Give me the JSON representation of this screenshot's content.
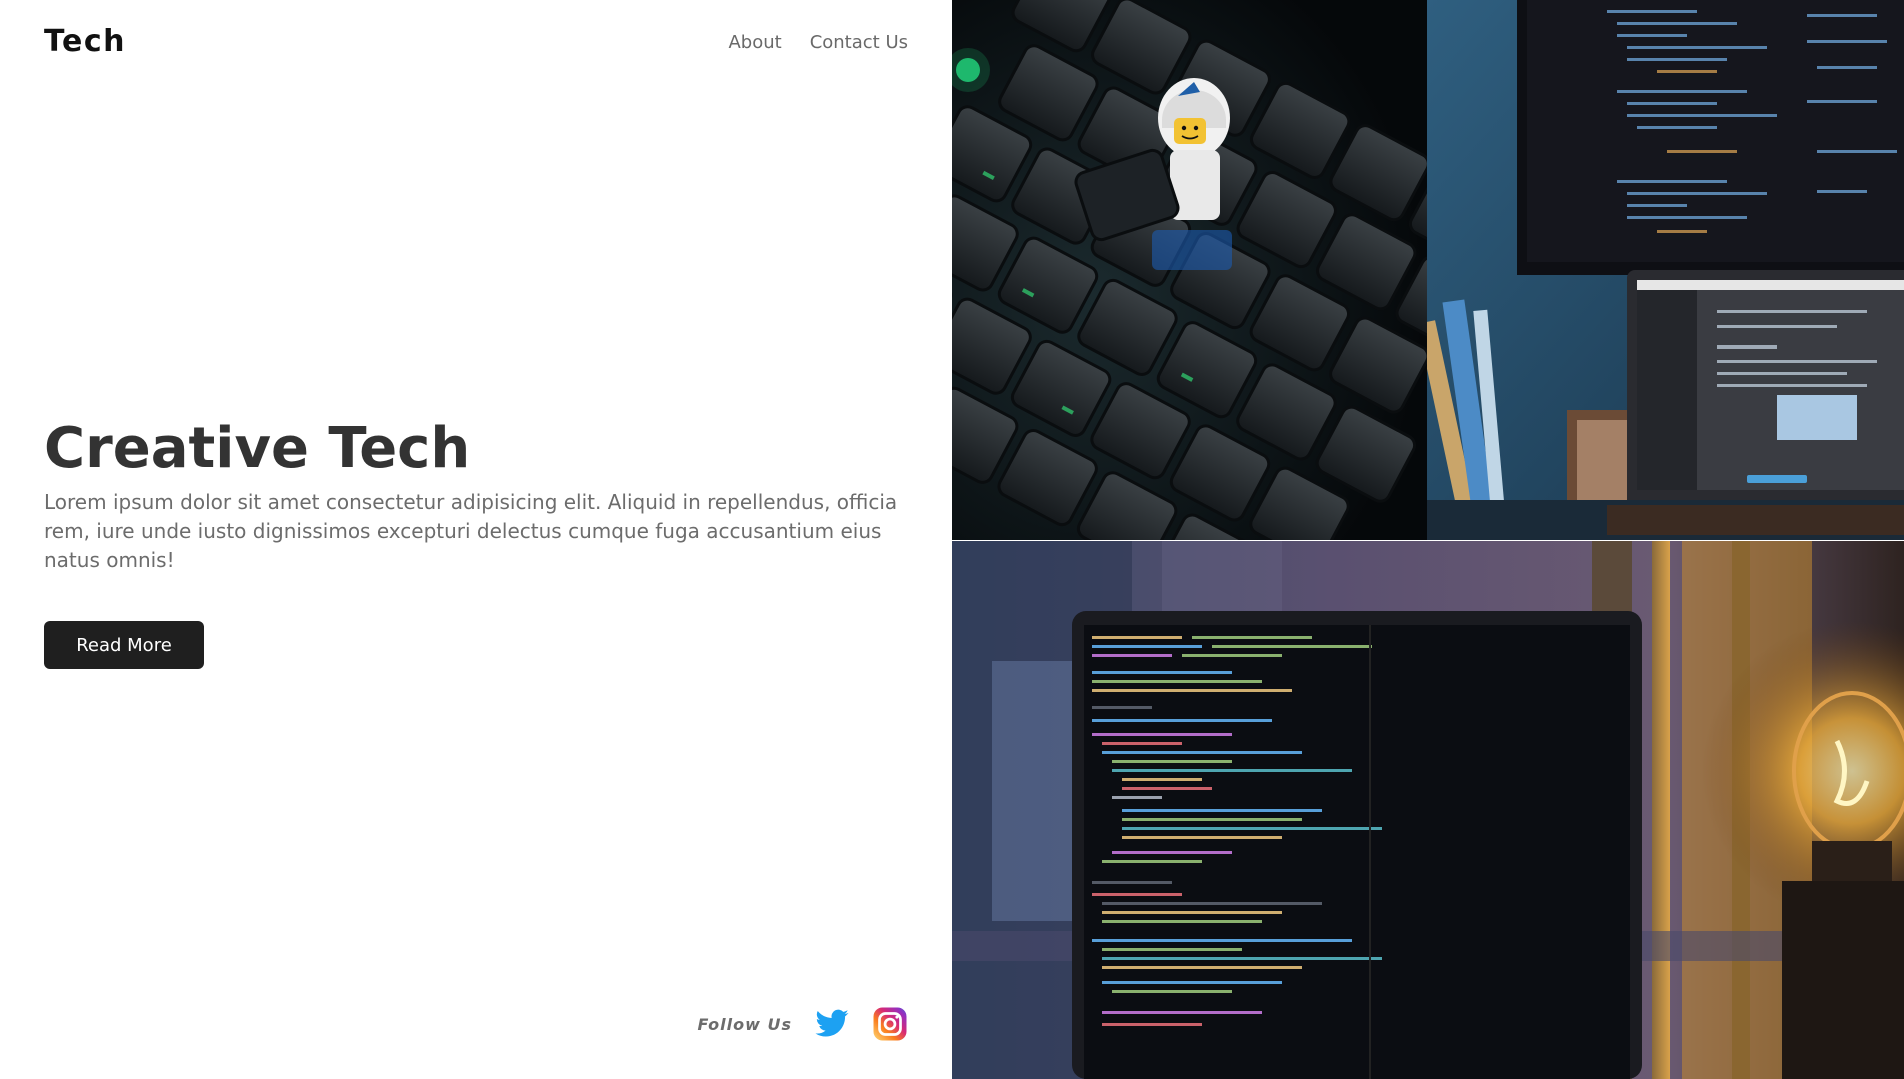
{
  "brand": {
    "logo": "Tech"
  },
  "nav": {
    "items": [
      "About",
      "Contact Us"
    ]
  },
  "hero": {
    "title": "Creative Tech",
    "text": "Lorem ipsum dolor sit amet consectetur adipisicing elit. Aliquid in repellendus, officia rem, iure unde iusto dignissimos excepturi delectus cumque fuga accusantium eius natus omnis!",
    "button": "Read More"
  },
  "social": {
    "label": "Follow Us",
    "icons": [
      "twitter-icon",
      "instagram-icon"
    ]
  },
  "colors": {
    "button_bg": "#1f1f1f",
    "twitter": "#1da1f2",
    "title": "#333333",
    "text": "#6c6c6c"
  }
}
